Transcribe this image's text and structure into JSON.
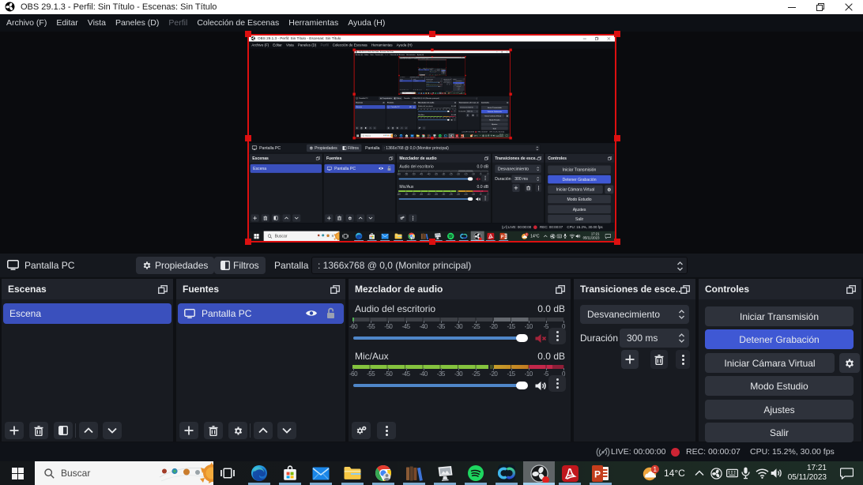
{
  "window": {
    "title": "OBS 29.1.3 - Perfil: Sin Título - Escenas: Sin Título",
    "buttons": [
      "minimize",
      "restore",
      "close"
    ]
  },
  "menu": {
    "items": [
      {
        "label": "Archivo (F)",
        "enabled": true
      },
      {
        "label": "Editar",
        "enabled": true
      },
      {
        "label": "Vista",
        "enabled": true
      },
      {
        "label": "Paneles (D)",
        "enabled": true
      },
      {
        "label": "Perfil",
        "enabled": false
      },
      {
        "label": "Colección de Escenas",
        "enabled": true
      },
      {
        "label": "Herramientas",
        "enabled": true
      },
      {
        "label": "Ayuda (H)",
        "enabled": true
      }
    ]
  },
  "context_bar": {
    "source_name": "Pantalla PC",
    "properties_label": "Propiedades",
    "filters_label": "Filtros",
    "field_label": "Pantalla",
    "field_value": ": 1366x768 @ 0,0 (Monitor principal)"
  },
  "panels": {
    "scenes": {
      "title": "Escenas",
      "items": [
        "Escena"
      ]
    },
    "sources": {
      "title": "Fuentes",
      "items": [
        "Pantalla PC"
      ]
    },
    "mixer": {
      "title": "Mezclador de audio",
      "ticks": [
        "-60",
        "-55",
        "-50",
        "-45",
        "-40",
        "-35",
        "-30",
        "-25",
        "-20",
        "-15",
        "-10",
        "-5",
        "0"
      ],
      "channels": [
        {
          "name": "Audio del escritorio",
          "db": "0.0 dB",
          "muted": true
        },
        {
          "name": "Mic/Aux",
          "db": "0.0 dB",
          "muted": false
        }
      ]
    },
    "transitions": {
      "title": "Transiciones de esce...",
      "transition": "Desvanecimiento",
      "duration_label": "Duración",
      "duration_value": "300 ms"
    },
    "controls": {
      "title": "Controles",
      "buttons": [
        "Iniciar Transmisión",
        "Detener Grabación",
        "Iniciar Cámara Virtual",
        "Modo Estudio",
        "Ajustes",
        "Salir"
      ]
    }
  },
  "status_bar": {
    "live": "LIVE: 00:00:00",
    "rec": "REC: 00:00:07",
    "stats": "CPU: 15.2%, 30.00 fps"
  },
  "taskbar": {
    "search_placeholder": "Buscar",
    "apps": [
      "task-view",
      "edge",
      "store",
      "mail",
      "explorer",
      "chrome",
      "books",
      "photos",
      "spotify",
      "uniconverter",
      "obs",
      "acrobat",
      "powerpoint"
    ],
    "tray": [
      "chevron-up",
      "cast",
      "keyboard",
      "microphone",
      "wifi",
      "volume"
    ],
    "weather_temp": "14°C",
    "weather_badge": "1",
    "powerpoint_letter": "P",
    "time": "17:21",
    "date": "05/11/2023"
  }
}
